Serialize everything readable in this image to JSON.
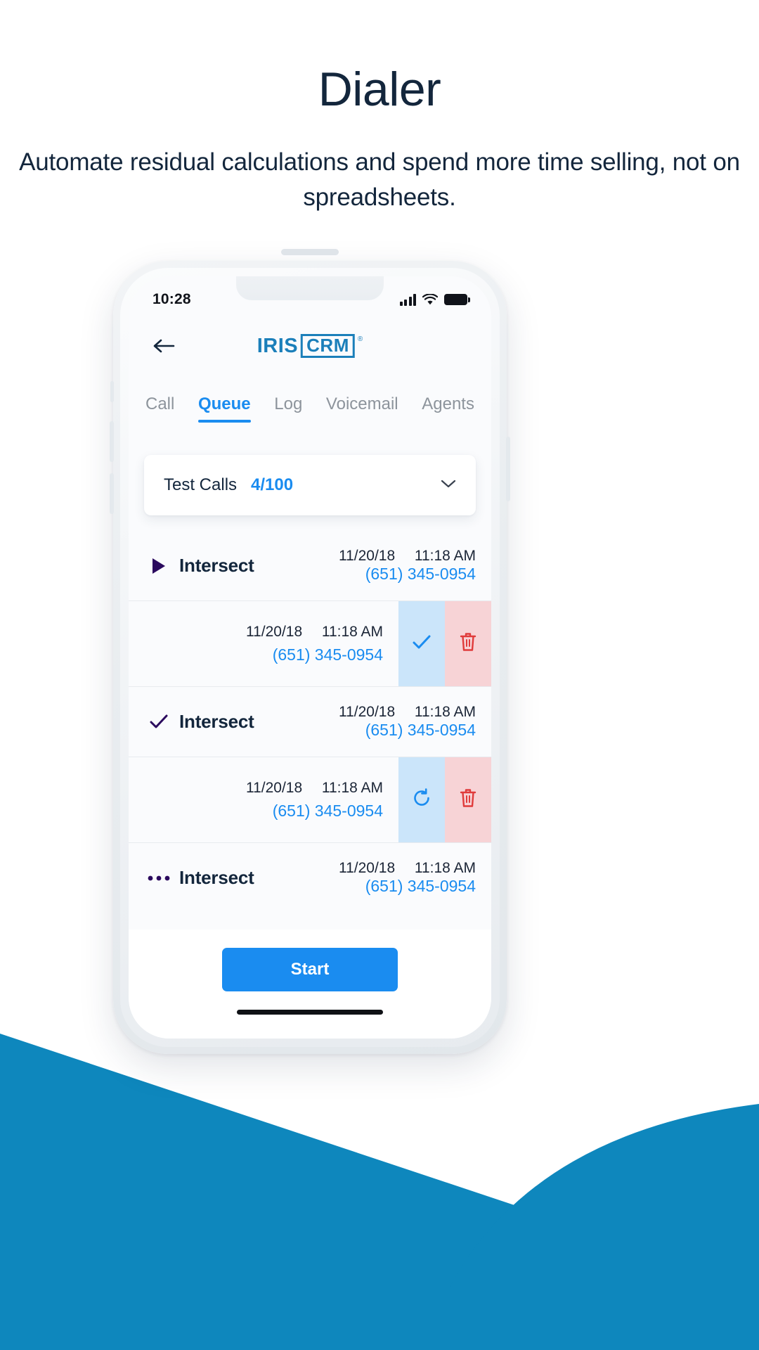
{
  "hero": {
    "title": "Dialer",
    "subtitle": "Automate residual calculations and spend more time selling, not on spreadsheets."
  },
  "colors": {
    "accent_blue": "#1a8cf0",
    "logo_blue": "#1b7fba",
    "wave_blue": "#0e87bd",
    "navy": "#13263c",
    "purple": "#2b0a5e",
    "danger_red": "#e03b3b",
    "confirm_panel": "#cbe5fa",
    "delete_panel": "#f7d3d6"
  },
  "phone": {
    "status_bar": {
      "time": "10:28",
      "signal_icon": "cellular-signal-icon",
      "wifi_icon": "wifi-icon",
      "battery_icon": "battery-full-icon"
    },
    "header": {
      "back_icon": "back-arrow-icon",
      "logo_primary": "IRIS",
      "logo_secondary": "CRM",
      "logo_trademark": "®"
    },
    "tabs": [
      {
        "label": "Call",
        "active": false
      },
      {
        "label": "Queue",
        "active": true
      },
      {
        "label": "Log",
        "active": false
      },
      {
        "label": "Voicemail",
        "active": false
      },
      {
        "label": "Agents",
        "active": false
      }
    ],
    "select_card": {
      "label": "Test Calls",
      "count": "4/100",
      "chevron_icon": "chevron-down-icon"
    },
    "queue_rows": [
      {
        "type": "entry",
        "state_icon": "play-triangle-icon",
        "name": "Intersect",
        "date": "11/20/18",
        "time": "11:18 AM",
        "phone": "(651) 345-0954"
      },
      {
        "type": "swipe",
        "date": "11/20/18",
        "time": "11:18 AM",
        "phone": "(651) 345-0954",
        "confirm_icon": "check-icon",
        "delete_icon": "trash-icon"
      },
      {
        "type": "entry",
        "state_icon": "check-icon",
        "name": "Intersect",
        "date": "11/20/18",
        "time": "11:18 AM",
        "phone": "(651) 345-0954"
      },
      {
        "type": "swipe",
        "date": "11/20/18",
        "time": "11:18 AM",
        "phone": "(651) 345-0954",
        "confirm_icon": "refresh-icon",
        "delete_icon": "trash-icon"
      },
      {
        "type": "entry",
        "state_icon": "ellipsis-icon",
        "name": "Intersect",
        "date": "11/20/18",
        "time": "11:18 AM",
        "phone": "(651) 345-0954"
      }
    ],
    "footer": {
      "start_label": "Start"
    }
  }
}
